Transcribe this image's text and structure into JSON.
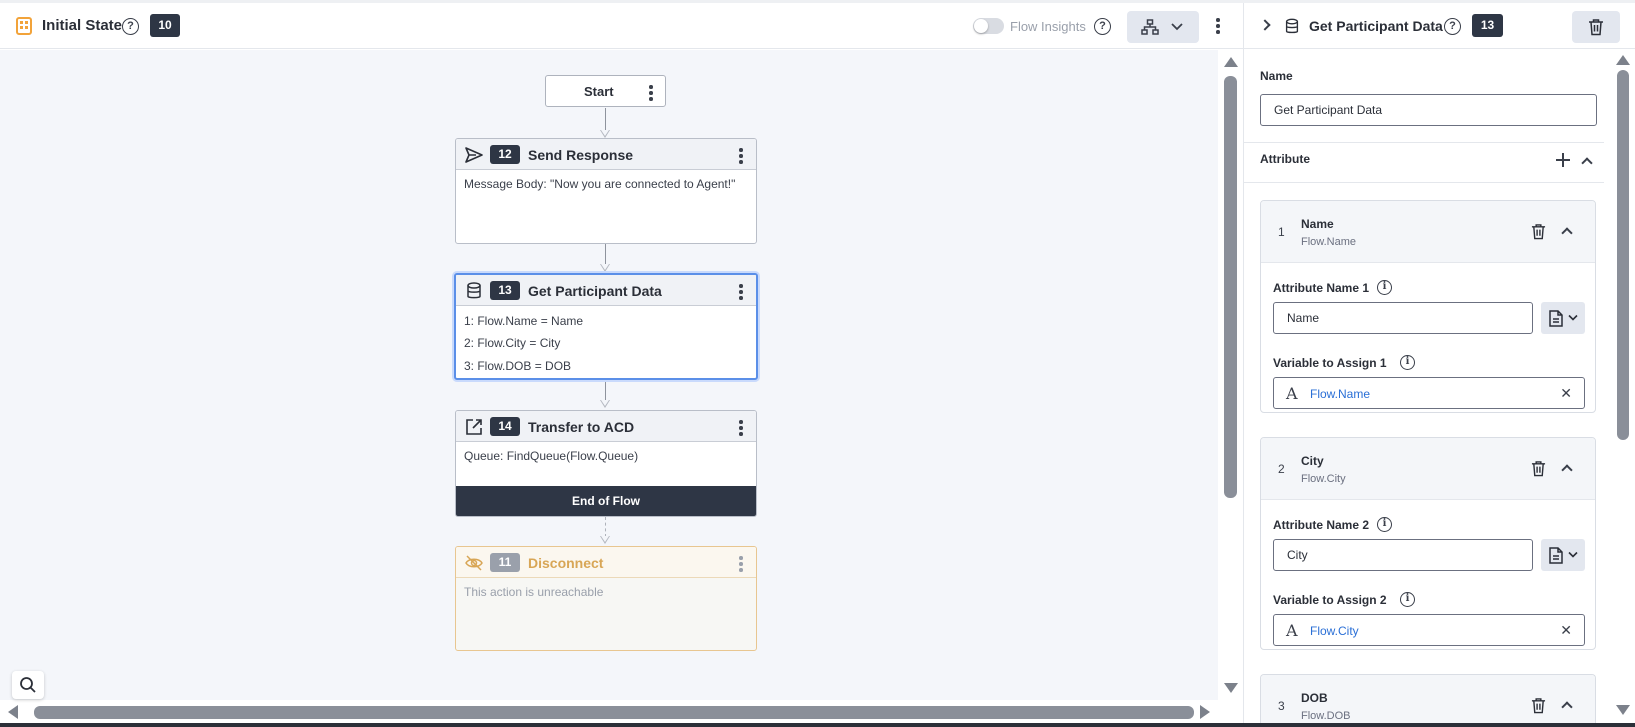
{
  "header": {
    "title": "Initial State",
    "help": "?",
    "state_id": "10",
    "flow_insights_label": "Flow Insights"
  },
  "flow": {
    "start_label": "Start",
    "nodes": [
      {
        "id": "12",
        "title": "Send Response",
        "icon": "send-icon",
        "lines": [
          "Message Body: \"Now you are connected to Agent!\""
        ]
      },
      {
        "id": "13",
        "title": "Get Participant Data",
        "icon": "database-icon",
        "lines": [
          "1: Flow.Name = Name",
          "2: Flow.City = City",
          "3: Flow.DOB = DOB"
        ]
      },
      {
        "id": "14",
        "title": "Transfer to ACD",
        "icon": "external-link-icon",
        "lines": [
          "Queue: FindQueue(Flow.Queue)"
        ],
        "footer": "End of Flow"
      },
      {
        "id": "11",
        "title": "Disconnect",
        "icon": "eye-off-icon",
        "lines": [
          "This action is unreachable"
        ]
      }
    ]
  },
  "panel": {
    "title": "Get Participant Data",
    "help": "?",
    "id": "13",
    "name_label": "Name",
    "name_value": "Get Participant Data",
    "attribute_label": "Attribute",
    "attributes": [
      {
        "index": "1",
        "name": "Name",
        "sub": "Flow.Name",
        "attr_label": "Attribute Name 1",
        "attr_value": "Name",
        "var_label": "Variable to Assign 1",
        "var_value": "Flow.Name",
        "var_letter": "A",
        "clear": "✕"
      },
      {
        "index": "2",
        "name": "City",
        "sub": "Flow.City",
        "attr_label": "Attribute Name 2",
        "attr_value": "City",
        "var_label": "Variable to Assign 2",
        "var_value": "Flow.City",
        "var_letter": "A",
        "clear": "✕"
      },
      {
        "index": "3",
        "name": "DOB",
        "sub": "Flow.DOB"
      }
    ],
    "info": "i"
  },
  "colors": {
    "accent": "#5b8fe8",
    "badge": "#2e3645",
    "warning": "#d8a656",
    "link": "#2a6fd6"
  }
}
